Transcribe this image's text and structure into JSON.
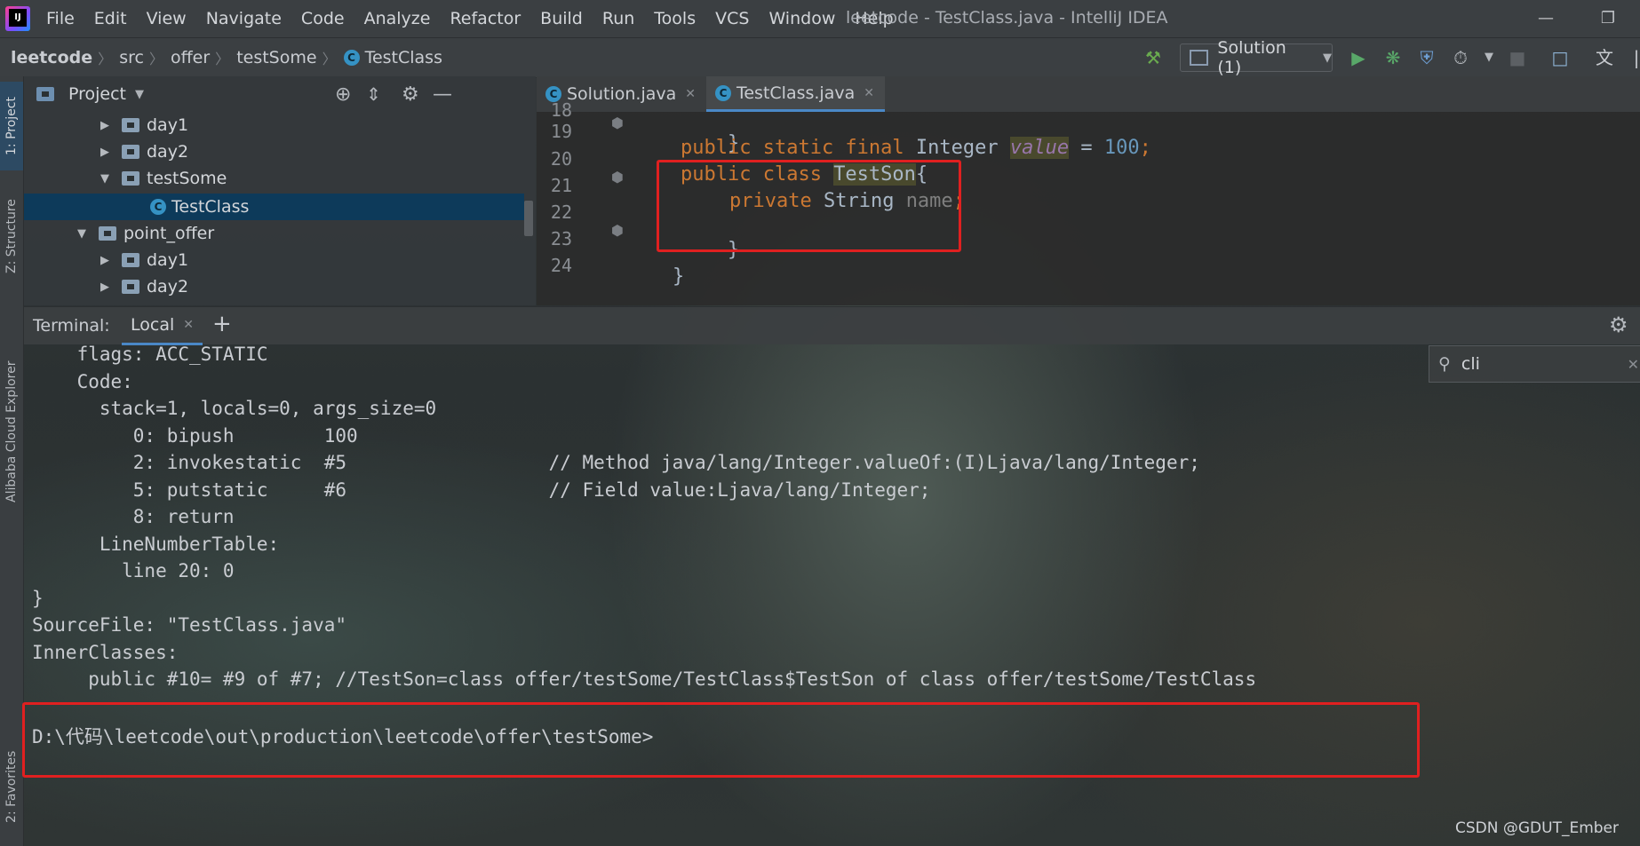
{
  "menubar": {
    "items": [
      "File",
      "Edit",
      "View",
      "Navigate",
      "Code",
      "Analyze",
      "Refactor",
      "Build",
      "Run",
      "Tools",
      "VCS",
      "Window",
      "Help"
    ],
    "window_title": "leetcode - TestClass.java - IntelliJ IDEA"
  },
  "breadcrumb": [
    "leetcode",
    "src",
    "offer",
    "testSome",
    "TestClass"
  ],
  "toolbar": {
    "run_config": "Solution (1)"
  },
  "left_stripe": {
    "project_tab": "1: Project",
    "structure_tab": "Z: Structure",
    "cloud_tab": "Alibaba Cloud Explorer",
    "favorites_tab": "2: Favorites"
  },
  "project": {
    "title": "Project",
    "tree": [
      {
        "label": "day1",
        "expanded": false
      },
      {
        "label": "day2",
        "expanded": false
      },
      {
        "label": "testSome",
        "expanded": true
      },
      {
        "label": "TestClass",
        "selected": true
      },
      {
        "label": "point_offer",
        "expanded": true
      },
      {
        "label": "day1",
        "expanded": false
      },
      {
        "label": "day2",
        "expanded": false
      }
    ]
  },
  "editor": {
    "tabs": [
      {
        "label": "Solution.java",
        "active": false
      },
      {
        "label": "TestClass.java",
        "active": true
      }
    ],
    "line_numbers": [
      "18",
      "19",
      "20",
      "21",
      "22",
      "23",
      "24"
    ],
    "code": {
      "l19": "}",
      "l20": {
        "kw1": "public static final ",
        "type": "Integer ",
        "field": "value",
        "eq": " = ",
        "num": "100",
        "semi": ";"
      },
      "l21": {
        "kw": "public class ",
        "name": "TestSon",
        "brace": "{"
      },
      "l22": {
        "kw": "private ",
        "type": "String ",
        "field": "name",
        "semi": ";"
      },
      "l23": "}",
      "l24": "}"
    }
  },
  "terminal": {
    "label": "Terminal:",
    "tab": "Local",
    "search": "cli",
    "lines": [
      "    flags: ACC_STATIC",
      "    Code:",
      "      stack=1, locals=0, args_size=0",
      "         0: bipush        100",
      "         2: invokestatic  #5                  // Method java/lang/Integer.valueOf:(I)Ljava/lang/Integer;",
      "         5: putstatic     #6                  // Field value:Ljava/lang/Integer;",
      "         8: return",
      "      LineNumberTable:",
      "        line 20: 0",
      "}",
      "SourceFile: \"TestClass.java\"",
      "InnerClasses:",
      "     public #10= #9 of #7; //TestSon=class offer/testSome/TestClass$TestSon of class offer/testSome/TestClass",
      "",
      "D:\\代码\\leetcode\\out\\production\\leetcode\\offer\\testSome>"
    ]
  },
  "watermark": "CSDN @GDUT_Ember",
  "colors": {
    "highlight_box": "#e02020",
    "keyword": "#cc7832",
    "field": "#9876aa",
    "number": "#6897bb",
    "selection": "#0d3a5a"
  }
}
